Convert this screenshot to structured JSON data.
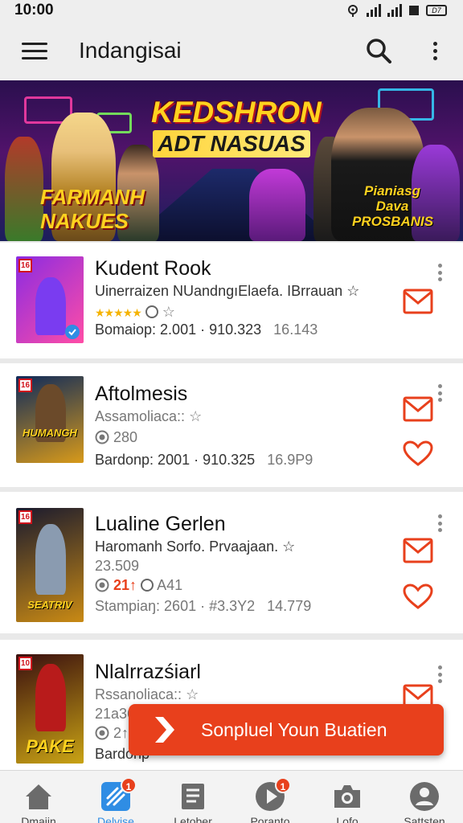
{
  "status_bar": {
    "time": "10:00",
    "battery": "D7"
  },
  "app_bar": {
    "title": "Indangisai"
  },
  "banner": {
    "title": "KEDSHRON",
    "subtitle": "ADT NASUAS",
    "left_caption": "FARMANH NAKUES",
    "right_caption": "Pianiasg Dava PROSBANIS"
  },
  "games": [
    {
      "age": "16",
      "title": "Kudent Rook",
      "line1": "Uinerraizen NUandngıElaefa. IBrrauan",
      "line1_icon": "☆",
      "stars": "★★★★★",
      "stars_icon": "☆",
      "meta": "Bomaiop: 2.001 · 910.323",
      "size": "16.143",
      "thumb_logo": "",
      "colors": {
        "bg1": "#8a2be2",
        "bg2": "#ff4da6",
        "hero": "#7a3cf0"
      }
    },
    {
      "age": "16",
      "title": "Aftolmesis",
      "line1": "Assamoliaca::",
      "line1_icon": "☆",
      "count": "280",
      "meta": "Bardonp: 2001 · 910.325",
      "size": "16.9P9",
      "thumb_logo": "HUMANGH",
      "colors": {
        "bg1": "#0f2a5a",
        "bg2": "#d89a1a",
        "hero": "#6b4a2a"
      }
    },
    {
      "age": "16",
      "title": "Lualine Gerlen",
      "line1": "Haromanh Sorfo. Prvaajaan.",
      "line1_icon": "☆",
      "line2": "23.509",
      "count": "21↑",
      "count2": "A41",
      "meta": "Stampiaŋ: 2601 · #3.3Y2",
      "size": "14.779",
      "thumb_logo": "SEATRIV",
      "colors": {
        "bg1": "#1a1a2e",
        "bg2": "#c98a14",
        "hero": "#8a9bb0"
      }
    },
    {
      "age": "10",
      "title": "Nlalrrazśiarl",
      "line1": "Rssanoliaca::",
      "line1_icon": "☆",
      "line2": "21a36",
      "count": "2↑",
      "meta": "Bardonp",
      "thumb_logo": "PAKE",
      "colors": {
        "bg1": "#3a0f0f",
        "bg2": "#c9a314",
        "hero": "#b81b1b"
      }
    }
  ],
  "toast": {
    "label": "Sonpluel Youn Buatien"
  },
  "bottom_nav": [
    {
      "label": "Dmajin",
      "badge": ""
    },
    {
      "label": "Delvise",
      "badge": "1"
    },
    {
      "label": "Letober",
      "badge": ""
    },
    {
      "label": "Poranto",
      "badge": "1"
    },
    {
      "label": "Lofo",
      "badge": ""
    },
    {
      "label": "Sattsten",
      "badge": ""
    }
  ],
  "colors": {
    "accent": "#e8401c",
    "active_nav": "#2f8de4",
    "background": "#e9e9e9"
  }
}
